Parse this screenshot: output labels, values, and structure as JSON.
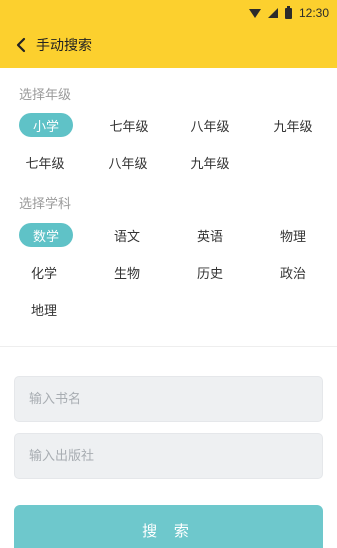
{
  "status_bar": {
    "time": "12:30",
    "icons": [
      "wifi-icon",
      "signal-icon",
      "battery-icon"
    ]
  },
  "header": {
    "title": "手动搜索",
    "back_icon": "chevron-left-icon"
  },
  "grade_section": {
    "label": "选择年级",
    "options": [
      "小学",
      "七年级",
      "八年级",
      "九年级",
      "七年级",
      "八年级",
      "九年级"
    ],
    "selected": "小学"
  },
  "subject_section": {
    "label": "选择学科",
    "options": [
      "数学",
      "语文",
      "英语",
      "物理",
      "化学",
      "生物",
      "历史",
      "政治",
      "地理"
    ],
    "selected": "数学"
  },
  "search_form": {
    "book_placeholder": "输入书名",
    "publisher_placeholder": "输入出版社",
    "book_value": "",
    "publisher_value": "",
    "submit_label": "搜 索"
  },
  "colors": {
    "header_bg": "#fcd02e",
    "accent": "#5fc2c7",
    "button": "#6ec8cc"
  }
}
